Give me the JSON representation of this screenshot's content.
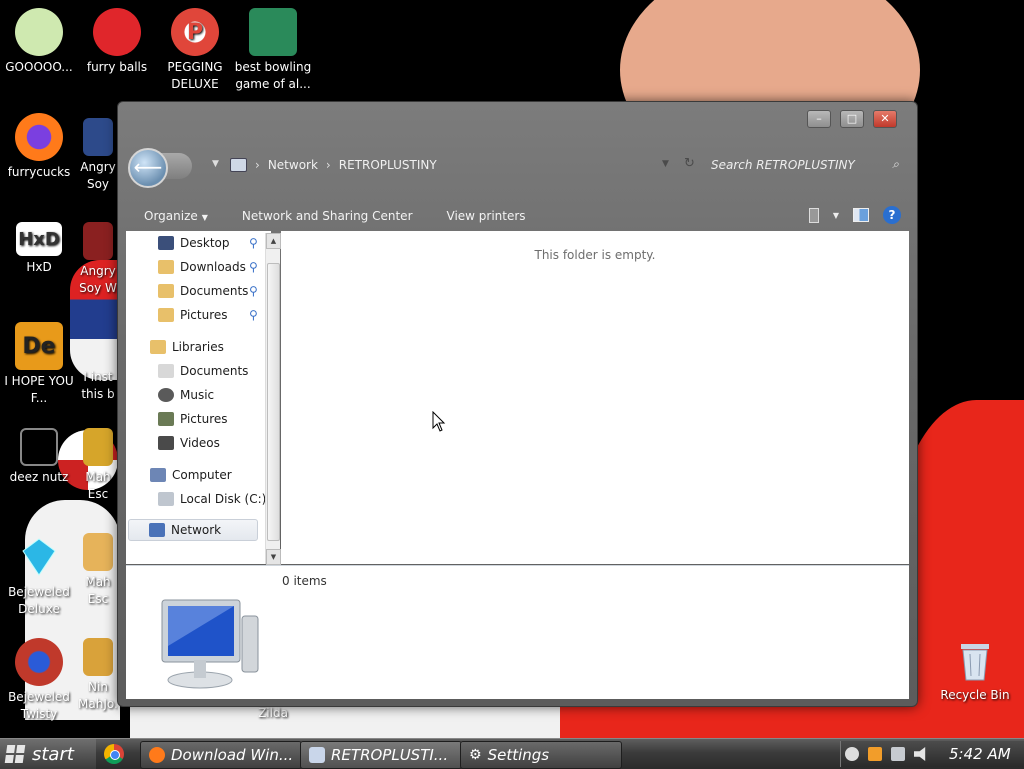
{
  "desktop": {
    "icons": [
      {
        "label": "GOOOOO...",
        "color": "#cfe9b0"
      },
      {
        "label": "furry balls",
        "color": "#e0262b"
      },
      {
        "label": "PEGGING DELUXE",
        "color": "#e0463a"
      },
      {
        "label": "best bowling game of al...",
        "color": "#2a8a5a"
      },
      {
        "label": "furrycucks",
        "color": "#ff7a1a"
      },
      {
        "label": "Angry Soy",
        "color": "#2d4a8a"
      },
      {
        "label": "HxD",
        "color": "#ffffff"
      },
      {
        "label": "Angry Soy W",
        "color": "#8a2020"
      },
      {
        "label": "I HOPE YOU F...",
        "color": "#e89a1a"
      },
      {
        "label": "I inst this b",
        "color": "#7a7a7a"
      },
      {
        "label": "deez nutz",
        "color": "#888888"
      },
      {
        "label": "Mah Esc",
        "color": "#d6a52a"
      },
      {
        "label": "Bejeweled Deluxe",
        "color": "#2bb7e6"
      },
      {
        "label": "Mah Esc",
        "color": "#e6b35a"
      },
      {
        "label": "Bejeweled Twisty",
        "color": "#c0392b"
      },
      {
        "label": "Nin MahJo...",
        "color": "#d9a23a"
      },
      {
        "label": "Zilda",
        "color": "#e2e2e2"
      },
      {
        "label": "Recycle Bin",
        "color": "#d9e4f0"
      }
    ]
  },
  "window": {
    "title_buttons": {
      "minimize": "–",
      "maximize": "□",
      "close": "✕"
    },
    "back_icon": "arrow-left-icon",
    "address": {
      "segments": [
        "Network",
        "RETROPLUSTINY"
      ],
      "separator": "›"
    },
    "search": {
      "placeholder": "Search RETROPLUSTINY"
    },
    "toolbar": {
      "organize": "Organize",
      "network_sharing": "Network and Sharing Center",
      "view_printers": "View printers",
      "help": "?"
    },
    "nav": {
      "favorites": [
        {
          "label": "Desktop",
          "icon": "desktop-icon",
          "color": "#3b4f7a"
        },
        {
          "label": "Downloads",
          "icon": "downloads-folder-icon",
          "color": "#e8c06a"
        },
        {
          "label": "Documents",
          "icon": "documents-folder-icon",
          "color": "#e8c06a"
        },
        {
          "label": "Pictures",
          "icon": "pictures-folder-icon",
          "color": "#e8c06a"
        }
      ],
      "libraries_label": "Libraries",
      "libraries": [
        {
          "label": "Documents",
          "icon": "documents-library-icon",
          "color": "#d8d8d8"
        },
        {
          "label": "Music",
          "icon": "music-library-icon",
          "color": "#5a5a5a"
        },
        {
          "label": "Pictures",
          "icon": "pictures-library-icon",
          "color": "#6a7a55"
        },
        {
          "label": "Videos",
          "icon": "videos-library-icon",
          "color": "#4a4a4a"
        }
      ],
      "computer_label": "Computer",
      "local_disk": "Local Disk (C:)",
      "network_label": "Network"
    },
    "content": {
      "empty_message": "This folder is empty."
    },
    "details": {
      "items_count": "0 items"
    }
  },
  "taskbar": {
    "start_label": "start",
    "tasks": [
      {
        "label": "Download Win...",
        "icon": "firefox-icon",
        "color": "#ff7a1a"
      },
      {
        "label": "RETROPLUSTI...",
        "icon": "network-icon",
        "color": "#c9d6ea"
      },
      {
        "label": "Settings",
        "icon": "gear-icon",
        "color": "#dddddd"
      }
    ],
    "clock": "5:42 AM"
  },
  "colors": {
    "accent": "#2a6fd0",
    "window_chrome": "#6a6a6a"
  }
}
